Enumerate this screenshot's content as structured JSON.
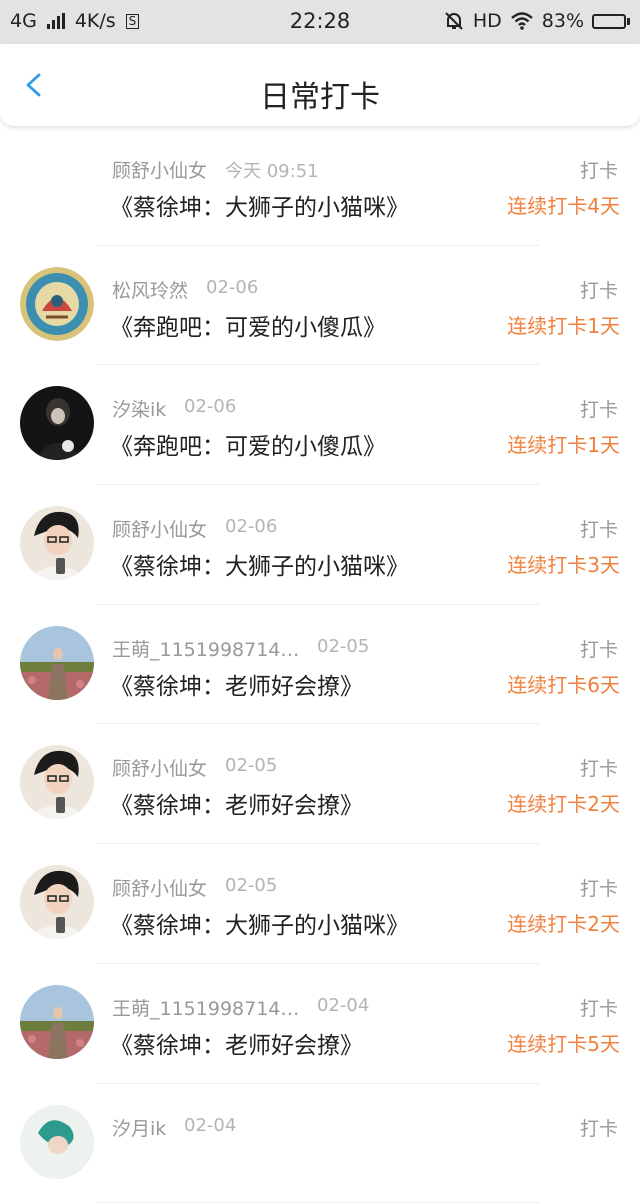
{
  "status_bar": {
    "network": "4G",
    "speed": "4K/s",
    "sim_icon": "S",
    "time": "22:28",
    "hd": "HD",
    "battery": "83%"
  },
  "header": {
    "title": "日常打卡"
  },
  "items": [
    {
      "user": "顾舒小仙女",
      "time": "今天 09:51",
      "book": "《蔡徐坤：大狮子的小猫咪》",
      "action": "打卡",
      "streak": "连续打卡4天",
      "avatar": "none"
    },
    {
      "user": "松风玲然",
      "time": "02-06",
      "book": "《奔跑吧：可爱的小傻瓜》",
      "action": "打卡",
      "streak": "连续打卡1天",
      "avatar": "emblem"
    },
    {
      "user": "汐染ik",
      "time": "02-06",
      "book": "《奔跑吧：可爱的小傻瓜》",
      "action": "打卡",
      "streak": "连续打卡1天",
      "avatar": "dark"
    },
    {
      "user": "顾舒小仙女",
      "time": "02-06",
      "book": "《蔡徐坤：大狮子的小猫咪》",
      "action": "打卡",
      "streak": "连续打卡3天",
      "avatar": "boy"
    },
    {
      "user": "王萌_1151998714…",
      "time": "02-05",
      "book": "《蔡徐坤：老师好会撩》",
      "action": "打卡",
      "streak": "连续打卡6天",
      "avatar": "field"
    },
    {
      "user": "顾舒小仙女",
      "time": "02-05",
      "book": "《蔡徐坤：老师好会撩》",
      "action": "打卡",
      "streak": "连续打卡2天",
      "avatar": "boy"
    },
    {
      "user": "顾舒小仙女",
      "time": "02-05",
      "book": "《蔡徐坤：大狮子的小猫咪》",
      "action": "打卡",
      "streak": "连续打卡2天",
      "avatar": "boy"
    },
    {
      "user": "王萌_1151998714…",
      "time": "02-04",
      "book": "《蔡徐坤：老师好会撩》",
      "action": "打卡",
      "streak": "连续打卡5天",
      "avatar": "field"
    },
    {
      "user": "汐月ik",
      "time": "02-04",
      "book": "",
      "action": "打卡",
      "streak": "",
      "avatar": "partial"
    }
  ]
}
